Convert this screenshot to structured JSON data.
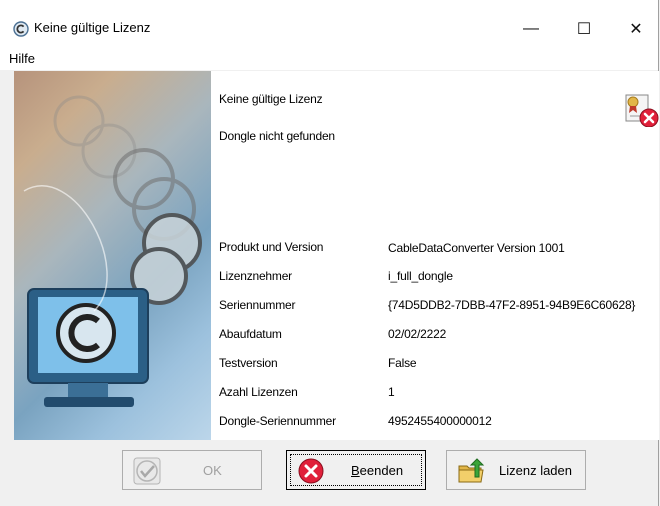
{
  "window": {
    "title": "Keine gültige Lizenz",
    "controls": {
      "minimize": "—",
      "maximize": "☐",
      "close": "✕"
    }
  },
  "menu": {
    "items": [
      {
        "label": "Hilfe"
      }
    ]
  },
  "message": {
    "line1": "Keine gültige Lizenz",
    "line2": "Dongle nicht gefunden"
  },
  "details": [
    {
      "label": "Produkt und Version",
      "value": "CableDataConverter   Version 1001"
    },
    {
      "label": "Lizenznehmer",
      "value": "i_full_dongle"
    },
    {
      "label": "Seriennummer",
      "value": "{74D5DDB2-7DBB-47F2-8951-94B9E6C60628}"
    },
    {
      "label": "Abaufdatum",
      "value": "02/02/2222"
    },
    {
      "label": "Testversion",
      "value": "False"
    },
    {
      "label": "Azahl Lizenzen",
      "value": "1"
    },
    {
      "label": "Dongle-Seriennummer",
      "value": "4952455400000012"
    }
  ],
  "buttons": {
    "ok": {
      "label": "OK",
      "enabled": false,
      "icon": "checkmark-icon"
    },
    "exit": {
      "label": "Beenden",
      "icon": "red-x-icon"
    },
    "load": {
      "label": "Lizenz laden",
      "icon": "folder-arrow-icon"
    }
  },
  "colors": {
    "error_red": "#e0203a",
    "content_bg": "#ffffff",
    "dialog_bg": "#f0f0f0"
  }
}
